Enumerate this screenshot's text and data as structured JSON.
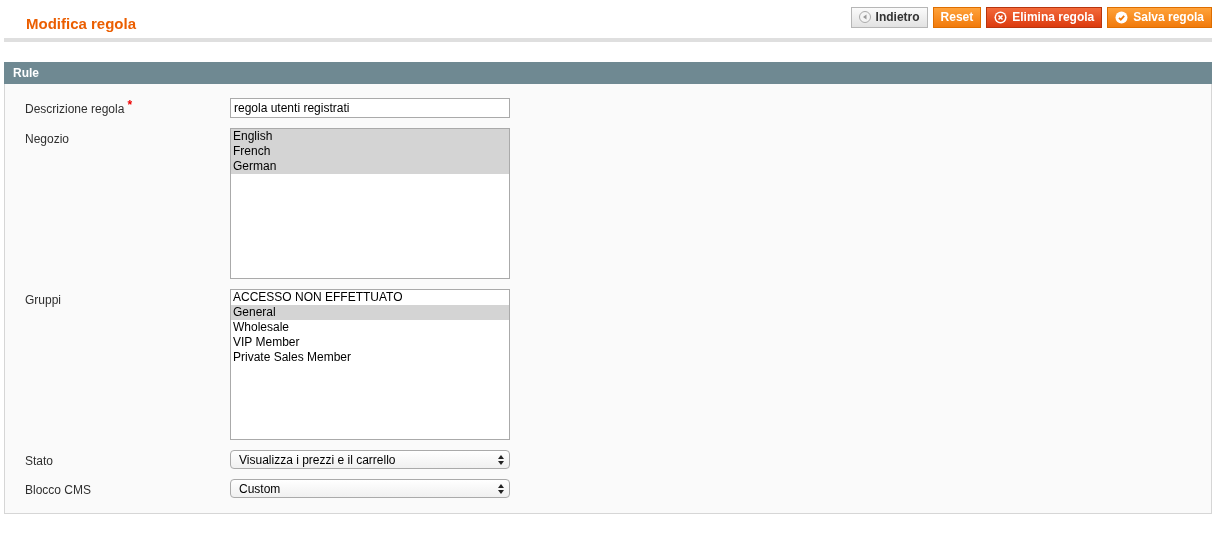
{
  "page": {
    "title": "Modifica regola"
  },
  "buttons": [
    {
      "label": "Indietro",
      "kind": "back"
    },
    {
      "label": "Reset",
      "kind": "reset"
    },
    {
      "label": "Elimina regola",
      "kind": "delete"
    },
    {
      "label": "Salva regola",
      "kind": "save"
    }
  ],
  "section": {
    "title": "Rule"
  },
  "fields": [
    {
      "label": "Descrizione regola",
      "required_mark": "*",
      "kind": "text",
      "value": "regola utenti registrati"
    },
    {
      "label": "Negozio",
      "kind": "multiselect",
      "options": [
        {
          "label": "English",
          "selected": true
        },
        {
          "label": "French",
          "selected": true
        },
        {
          "label": "German",
          "selected": true
        }
      ]
    },
    {
      "label": "Gruppi",
      "kind": "multiselect",
      "options": [
        {
          "label": "ACCESSO NON EFFETTUATO",
          "selected": false
        },
        {
          "label": "General",
          "selected": true
        },
        {
          "label": "Wholesale",
          "selected": false
        },
        {
          "label": "VIP Member",
          "selected": false
        },
        {
          "label": "Private Sales Member",
          "selected": false
        }
      ]
    },
    {
      "label": "Stato",
      "kind": "select",
      "value": "Visualizza i prezzi e il carrello"
    },
    {
      "label": "Blocco CMS",
      "kind": "select",
      "value": "Custom"
    }
  ]
}
